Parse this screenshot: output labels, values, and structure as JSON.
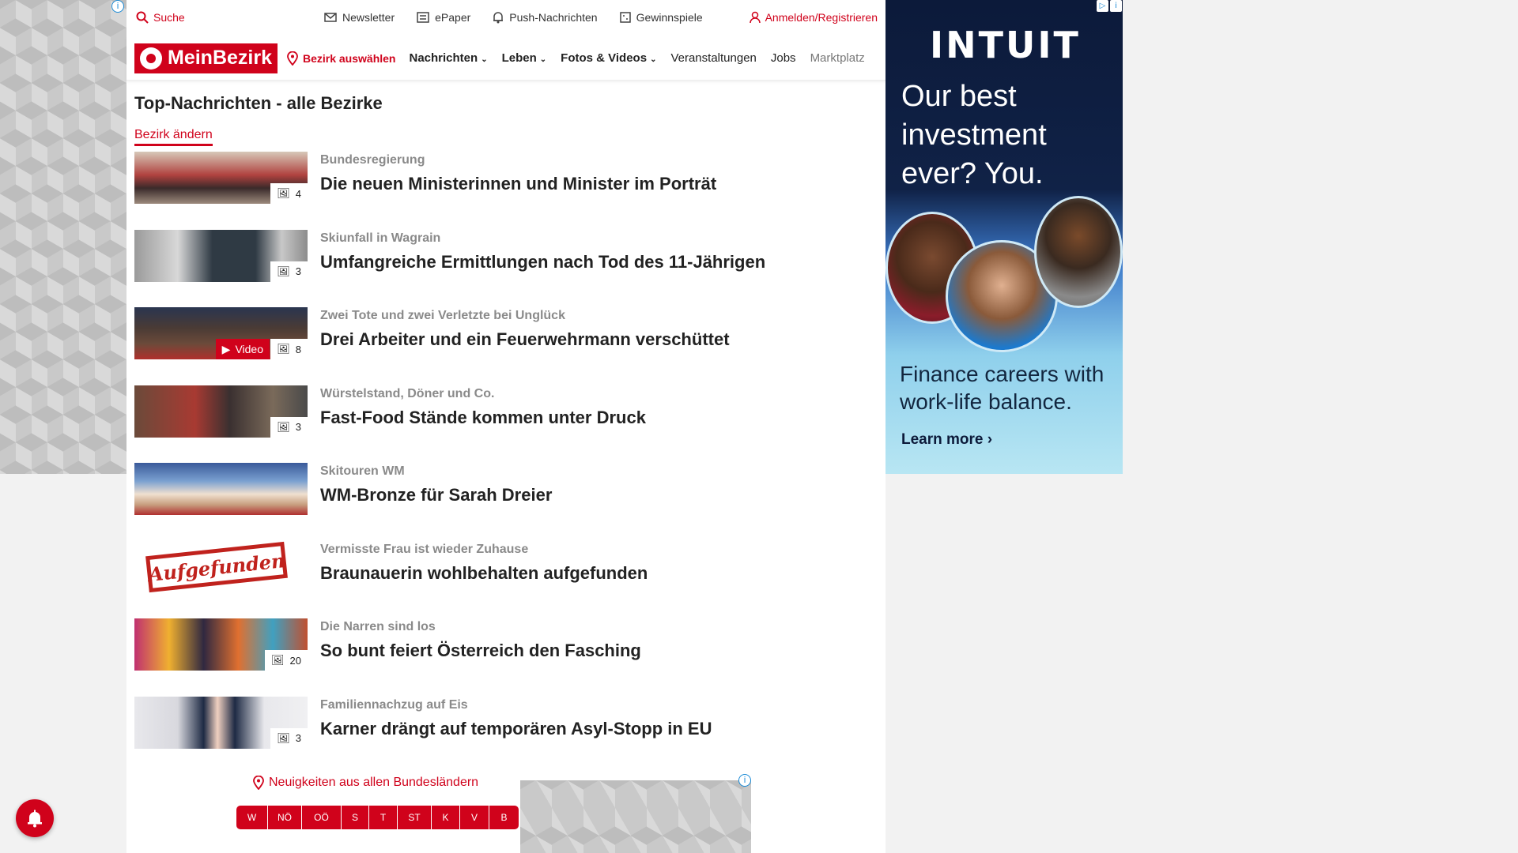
{
  "topbar": {
    "search_label": "Suche",
    "items": [
      {
        "label": "Newsletter",
        "icon": "mail-icon"
      },
      {
        "label": "ePaper",
        "icon": "newspaper-icon"
      },
      {
        "label": "Push-Nachrichten",
        "icon": "bell-icon"
      },
      {
        "label": "Gewinnspiele",
        "icon": "gift-icon"
      }
    ],
    "login_label": "Anmelden/Registrieren"
  },
  "navbar": {
    "logo_text": "MeinBezirk",
    "region_label": "Bezirk auswählen",
    "links": [
      {
        "label": "Nachrichten",
        "dropdown": true
      },
      {
        "label": "Leben",
        "dropdown": true
      },
      {
        "label": "Fotos & Videos",
        "dropdown": true
      },
      {
        "label": "Veranstaltungen",
        "dropdown": false
      },
      {
        "label": "Jobs",
        "dropdown": false
      },
      {
        "label": "Marktplatz",
        "dropdown": false
      }
    ]
  },
  "main": {
    "title": "Top-Nachrichten - alle Bezirke",
    "change_link": "Bezirk ändern",
    "articles": [
      {
        "kicker": "Bundesregierung",
        "headline": "Die neuen Ministerinnen und Minister im Porträt",
        "photos": "4",
        "video": null
      },
      {
        "kicker": "Skiunfall in Wagrain",
        "headline": "Umfangreiche Ermittlungen nach Tod des 11-Jährigen",
        "photos": "3",
        "video": null
      },
      {
        "kicker": "Zwei Tote und zwei Verletzte bei Unglück",
        "headline": "Drei Arbeiter und ein Feuerwehrmann verschüttet",
        "photos": "8",
        "video": "Video"
      },
      {
        "kicker": "Würstelstand, Döner und Co.",
        "headline": "Fast-Food Stände kommen unter Druck",
        "photos": "3",
        "video": null
      },
      {
        "kicker": "Skitouren WM",
        "headline": "WM-Bronze für Sarah Dreier",
        "photos": null,
        "video": null
      },
      {
        "kicker": "Vermisste Frau ist wieder Zuhause",
        "headline": "Braunauerin wohlbehalten aufgefunden",
        "photos": null,
        "video": null,
        "stamp": "Aufgefunden"
      },
      {
        "kicker": "Die Narren sind los",
        "headline": "So bunt feiert Österreich den Fasching",
        "photos": "20",
        "video": null
      },
      {
        "kicker": "Familiennachzug auf Eis",
        "headline": "Karner drängt auf temporären Asyl-Stopp in EU",
        "photos": "3",
        "video": null
      }
    ]
  },
  "regions": {
    "title": "Neuigkeiten aus allen Bundesländern",
    "items": [
      "W",
      "NÖ",
      "OÖ",
      "S",
      "T",
      "ST",
      "K",
      "V",
      "B"
    ]
  },
  "ad": {
    "brand": "INTUIT",
    "headline": "Our best investment ever? You.",
    "sub": "Finance careers with work-life balance.",
    "cta": "Learn more ›",
    "info_label": "i",
    "choice_label": "▷"
  },
  "colors": {
    "accent": "#d0021b",
    "text": "#222222",
    "muted": "#8a8a8a"
  }
}
